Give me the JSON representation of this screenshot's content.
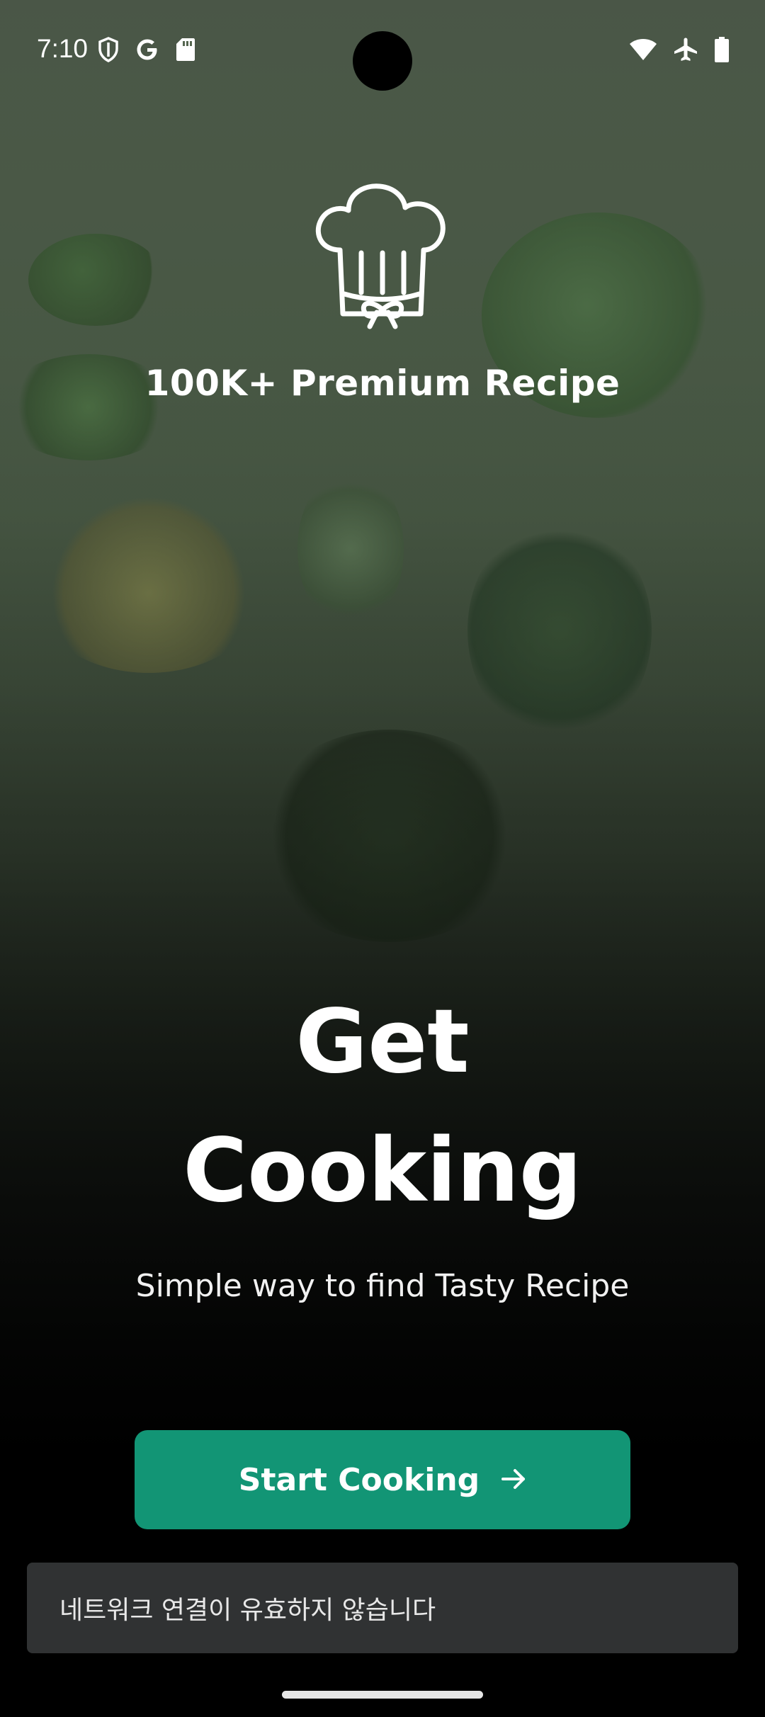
{
  "status_bar": {
    "time": "7:10",
    "left_icons": [
      "shield-icon",
      "google-icon",
      "sd-card-icon"
    ],
    "right_icons": [
      "wifi-icon",
      "airplane-mode-icon",
      "battery-icon"
    ]
  },
  "hero": {
    "tagline": "100K+ Premium Recipe",
    "headline_line1": "Get",
    "headline_line2": "Cooking",
    "subtitle": "Simple way to find Tasty Recipe"
  },
  "cta": {
    "label": "Start Cooking",
    "icon": "arrow-right-icon"
  },
  "snackbar": {
    "message": "네트워크 연결이 유효하지 않습니다"
  },
  "colors": {
    "accent": "#129575",
    "snackbar_bg": "#303233"
  }
}
